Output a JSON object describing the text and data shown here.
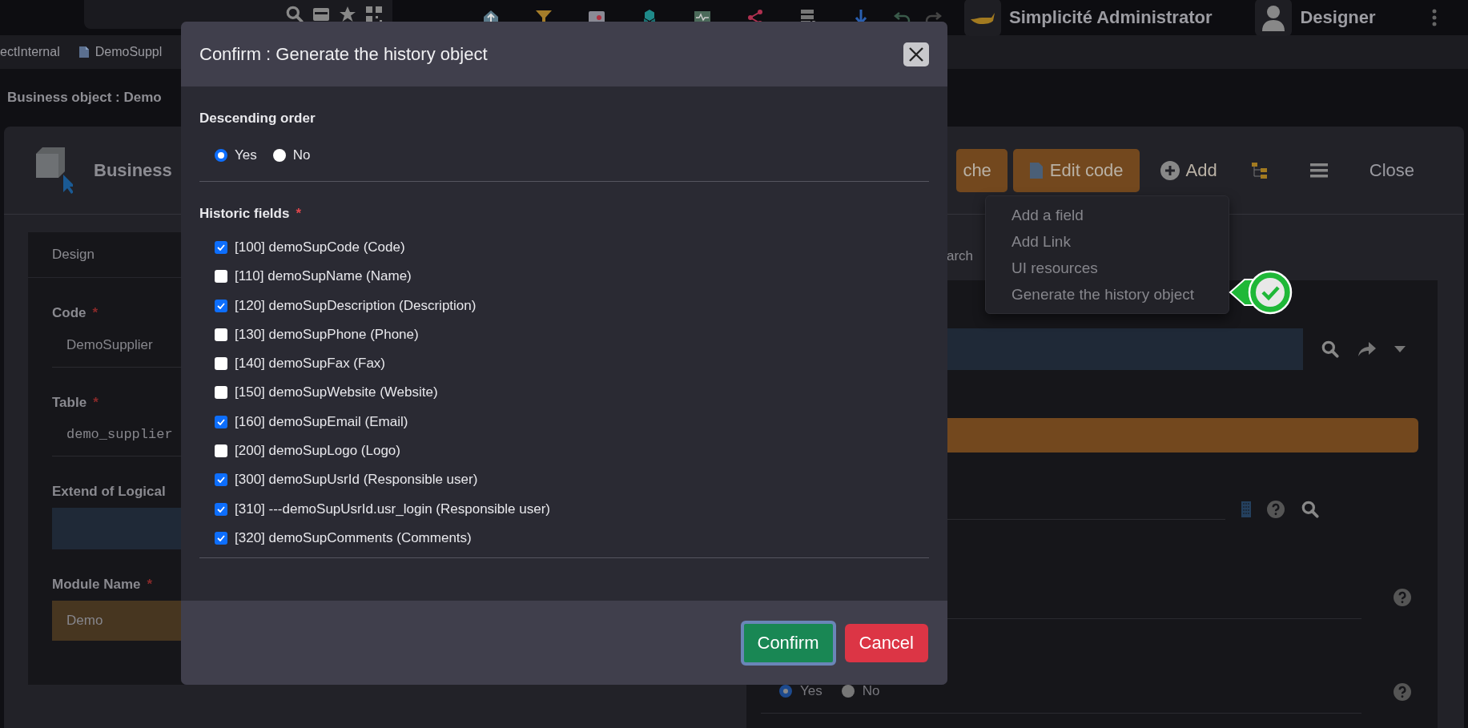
{
  "top_bar": {
    "app_title": "Simplicité Administrator",
    "user": "Designer"
  },
  "breadcrumbs": [
    {
      "label": "ectInternal",
      "icon": false
    },
    {
      "label": "DemoSuppl",
      "icon": true
    }
  ],
  "page_title": "Business object : Demo",
  "object_header": {
    "title": "Business",
    "buttons": [
      {
        "label": "che",
        "kind": "orange"
      },
      {
        "label": "Edit code",
        "kind": "orange-doc"
      },
      {
        "label": "Add",
        "kind": "plus"
      }
    ],
    "close": "Close"
  },
  "add_menu": {
    "items": [
      "Add a field",
      "Add Link",
      "UI resources",
      "Generate the history object"
    ]
  },
  "form_left": {
    "tab": "Design",
    "fields": [
      {
        "label": "Code",
        "mark": "*",
        "value": "DemoSupplier",
        "kind": "text"
      },
      {
        "label": "Table",
        "mark": "*",
        "value": "demo_supplier",
        "kind": "mono"
      },
      {
        "label": "Extend of Logical",
        "kind": "linked"
      },
      {
        "label": "Module Name",
        "mark": "*",
        "value": "Demo",
        "kind": "module"
      }
    ]
  },
  "form_right": {
    "tab": "arch",
    "radio_options": [
      {
        "label": "Yes",
        "selected": true
      },
      {
        "label": "No",
        "selected": false
      }
    ]
  },
  "dialog": {
    "title": "Confirm : Generate the history object",
    "order": {
      "label": "Descending order",
      "options": [
        {
          "label": "Yes",
          "selected": true
        },
        {
          "label": "No",
          "selected": false
        }
      ]
    },
    "fields_label": "Historic fields",
    "fields_mark": "*",
    "fields": [
      {
        "label": "[100] demoSupCode (Code)",
        "checked": true
      },
      {
        "label": "[110] demoSupName (Name)",
        "checked": false
      },
      {
        "label": "[120] demoSupDescription (Description)",
        "checked": true
      },
      {
        "label": "[130] demoSupPhone (Phone)",
        "checked": false
      },
      {
        "label": "[140] demoSupFax (Fax)",
        "checked": false
      },
      {
        "label": "[150] demoSupWebsite (Website)",
        "checked": false
      },
      {
        "label": "[160] demoSupEmail (Email)",
        "checked": true
      },
      {
        "label": "[200] demoSupLogo (Logo)",
        "checked": false
      },
      {
        "label": "[300] demoSupUsrId (Responsible user)",
        "checked": true
      },
      {
        "label": "[310] ---demoSupUsrId.usr_login (Responsible user)",
        "checked": true
      },
      {
        "label": "[320] demoSupComments (Comments)",
        "checked": true
      }
    ],
    "buttons": [
      {
        "label": "Confirm",
        "kind": "primary"
      },
      {
        "label": "Cancel",
        "kind": "danger"
      }
    ]
  }
}
